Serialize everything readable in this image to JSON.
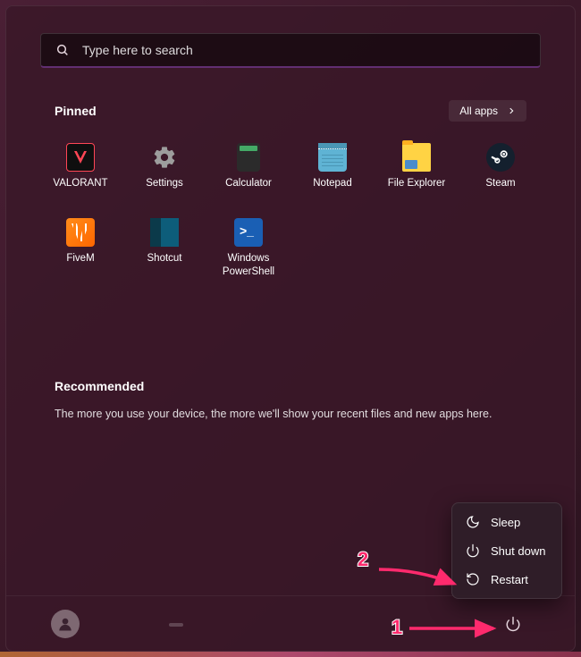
{
  "search": {
    "placeholder": "Type here to search"
  },
  "pinned": {
    "title": "Pinned",
    "all_apps_label": "All apps",
    "apps": [
      {
        "label": "VALORANT",
        "icon": "valorant"
      },
      {
        "label": "Settings",
        "icon": "settings"
      },
      {
        "label": "Calculator",
        "icon": "calculator"
      },
      {
        "label": "Notepad",
        "icon": "notepad"
      },
      {
        "label": "File Explorer",
        "icon": "explorer"
      },
      {
        "label": "Steam",
        "icon": "steam"
      },
      {
        "label": "FiveM",
        "icon": "fivem"
      },
      {
        "label": "Shotcut",
        "icon": "shotcut"
      },
      {
        "label": "Windows PowerShell",
        "icon": "powershell"
      }
    ]
  },
  "recommended": {
    "title": "Recommended",
    "text": "The more you use your device, the more we'll show your recent files and new apps here."
  },
  "power_menu": {
    "sleep": "Sleep",
    "shutdown": "Shut down",
    "restart": "Restart"
  },
  "annotations": {
    "num1": "1",
    "num2": "2"
  }
}
